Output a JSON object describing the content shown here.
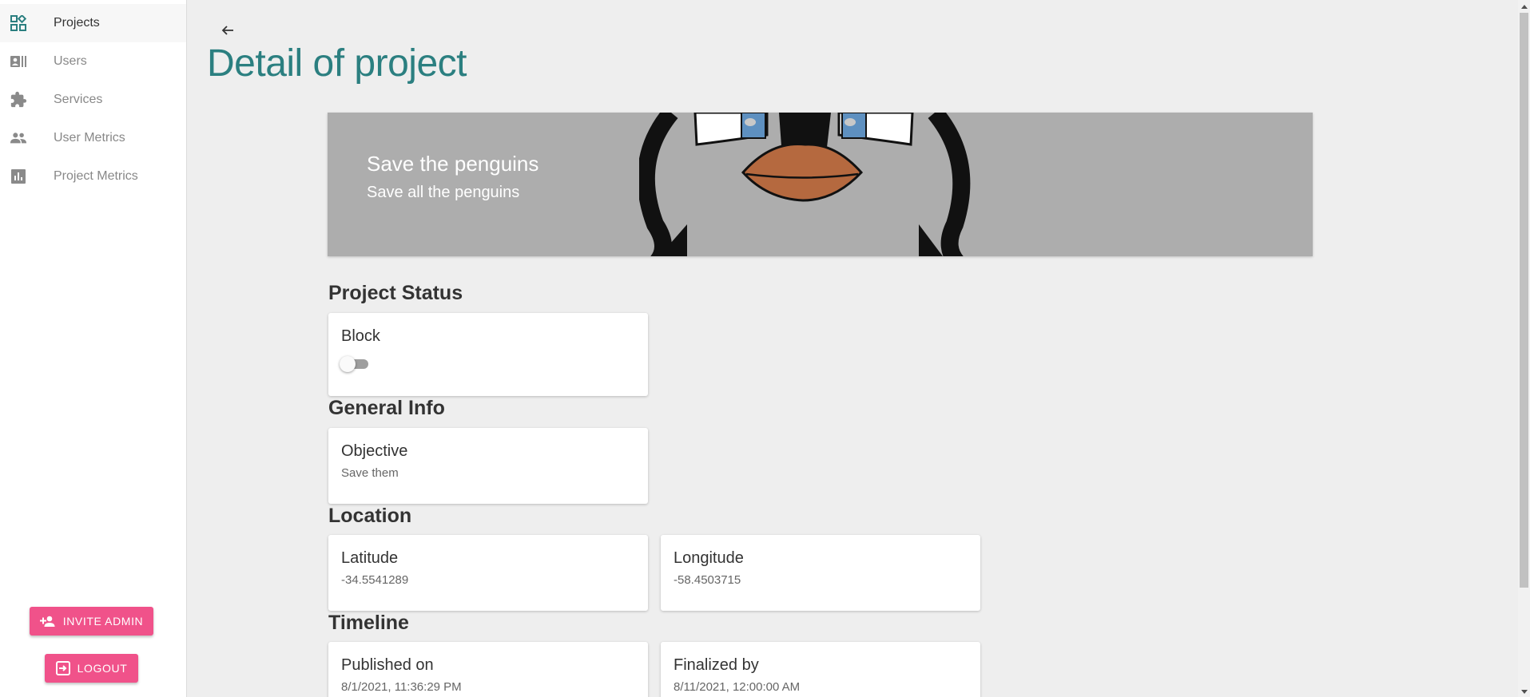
{
  "sidebar": {
    "items": [
      {
        "label": "Projects",
        "icon": "dashboard-icon",
        "active": true
      },
      {
        "label": "Users",
        "icon": "contacts-icon",
        "active": false
      },
      {
        "label": "Services",
        "icon": "puzzle-icon",
        "active": false
      },
      {
        "label": "User Metrics",
        "icon": "people-icon",
        "active": false
      },
      {
        "label": "Project Metrics",
        "icon": "bar-chart-icon",
        "active": false
      }
    ],
    "invite_label": "INVITE ADMIN",
    "logout_label": "LOGOUT"
  },
  "page": {
    "title": "Detail of project"
  },
  "banner": {
    "title": "Save the penguins",
    "subtitle": "Save all the penguins"
  },
  "sections": {
    "status": {
      "title": "Project Status",
      "block_label": "Block",
      "block_enabled": false
    },
    "general": {
      "title": "General Info",
      "objective_label": "Objective",
      "objective_value": "Save them"
    },
    "location": {
      "title": "Location",
      "latitude_label": "Latitude",
      "latitude_value": "-34.5541289",
      "longitude_label": "Longitude",
      "longitude_value": "-58.4503715"
    },
    "timeline": {
      "title": "Timeline",
      "published_label": "Published on",
      "published_value": "8/1/2021, 11:36:29 PM",
      "finalized_label": "Finalized by",
      "finalized_value": "8/11/2021, 12:00:00 AM"
    }
  },
  "colors": {
    "accent_teal": "#2b7f80",
    "button_pink": "#f0528a",
    "background": "#eeeeee"
  }
}
